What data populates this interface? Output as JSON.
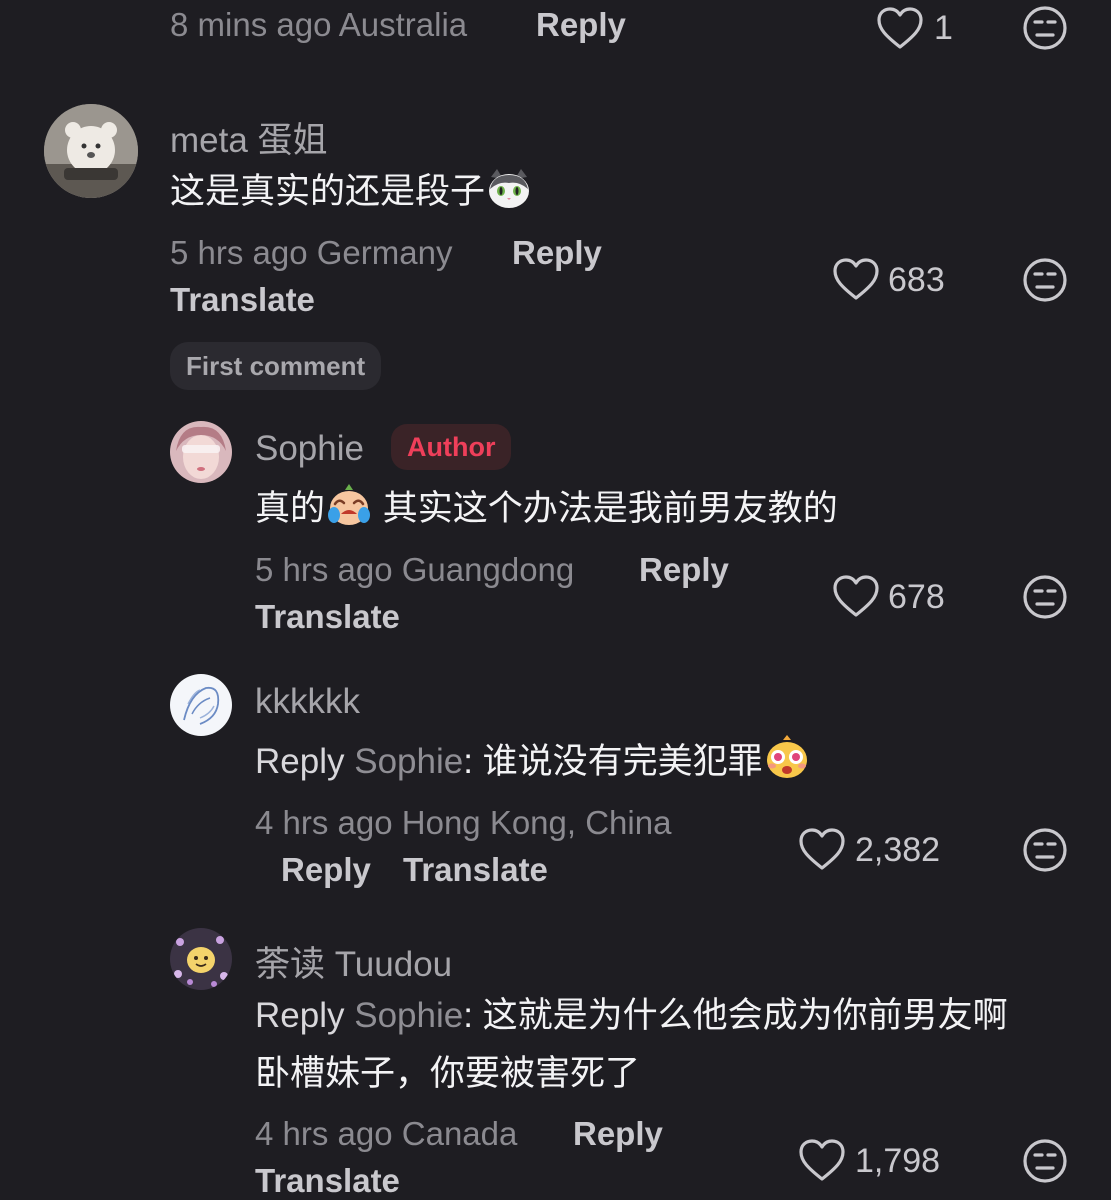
{
  "comments": [
    {
      "meta": "8 mins ago Australia",
      "reply_label": "Reply",
      "likes": "1"
    },
    {
      "username": "meta 蛋姐",
      "text": "这是真实的还是段子",
      "text_emoji": "cat-face-icon",
      "meta": "5 hrs ago Germany",
      "reply_label": "Reply",
      "translate_label": "Translate",
      "likes": "683",
      "badge": "First comment"
    }
  ],
  "replies": [
    {
      "username": "Sophie",
      "badge": "Author",
      "text_prefix": "真的",
      "text_emoji": "crying-face-icon",
      "text": " 其实这个办法是我前男友教的",
      "meta": "5 hrs ago Guangdong",
      "reply_label": "Reply",
      "translate_label": "Translate",
      "likes": "678"
    },
    {
      "username": "kkkkkk",
      "reply_prefix": "Reply",
      "reply_target": "Sophie",
      "text": ": 谁说没有完美犯罪",
      "text_emoji": "starstruck-face-icon",
      "meta": "4 hrs ago Hong Kong, China",
      "reply_label": "Reply",
      "translate_label": "Translate",
      "likes": "2,382"
    },
    {
      "username": "荼读 Tuudou",
      "reply_prefix": "Reply",
      "reply_target": "Sophie",
      "text_line1": ": 这就是为什么他会成为你前男友啊",
      "text_line2": "卧槽妹子，你要被害死了",
      "meta": "4 hrs ago Canada",
      "reply_label": "Reply",
      "translate_label": "Translate",
      "likes": "1,798"
    }
  ],
  "colors": {
    "background": "#1e1d22",
    "author_badge": "#ef3f5a"
  }
}
